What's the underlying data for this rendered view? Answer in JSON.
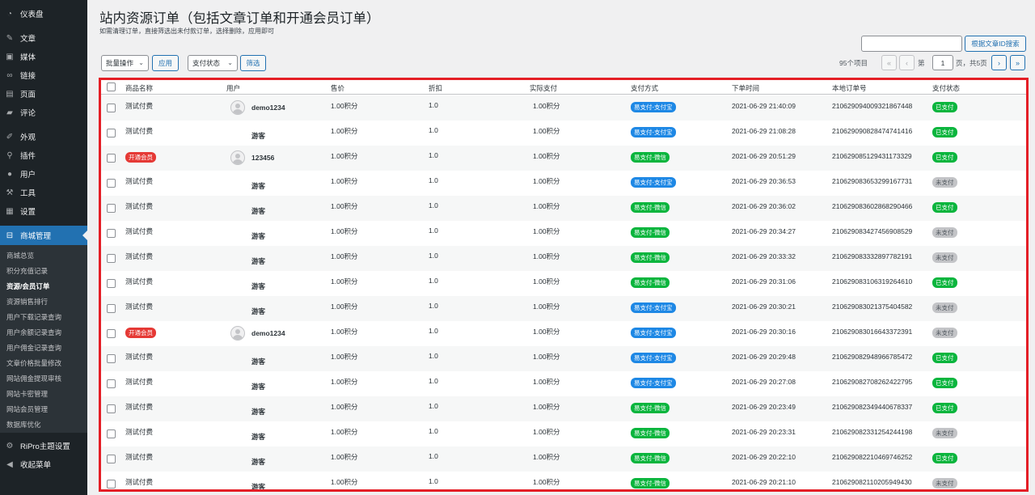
{
  "sidebar": {
    "items": [
      {
        "label": "仪表盘",
        "icon": "dashboard-icon",
        "glyph": "◔"
      },
      {
        "label": "文章",
        "icon": "pin-icon",
        "glyph": "✎"
      },
      {
        "label": "媒体",
        "icon": "media-icon",
        "glyph": "▣"
      },
      {
        "label": "链接",
        "icon": "link-icon",
        "glyph": "∞"
      },
      {
        "label": "页面",
        "icon": "page-icon",
        "glyph": "▤"
      },
      {
        "label": "评论",
        "icon": "comment-icon",
        "glyph": "▰"
      },
      {
        "label": "外观",
        "icon": "appearance-icon",
        "glyph": "✐"
      },
      {
        "label": "插件",
        "icon": "plugin-icon",
        "glyph": "⚲"
      },
      {
        "label": "用户",
        "icon": "user-icon",
        "glyph": "●"
      },
      {
        "label": "工具",
        "icon": "tools-icon",
        "glyph": "⚒"
      },
      {
        "label": "设置",
        "icon": "settings-icon",
        "glyph": "▦"
      },
      {
        "label": "商城管理",
        "icon": "cart-icon",
        "glyph": "⊟"
      },
      {
        "label": "RiPro主题设置",
        "icon": "gear-icon",
        "glyph": "⚙"
      },
      {
        "label": "收起菜单",
        "icon": "collapse-icon",
        "glyph": "◀"
      }
    ],
    "submenu": [
      "商城总览",
      "积分充值记录",
      "资源/会员订单",
      "资源销售排行",
      "用户下载记录查询",
      "用户余额记录查询",
      "用户佣金记录查询",
      "文章价格批量修改",
      "网站佣金提现审核",
      "网站卡密管理",
      "网站会员管理",
      "数据库优化"
    ]
  },
  "page": {
    "title": "站内资源订单（包括文章订单和开通会员订单）",
    "description": "如需清理订单，直接筛选出未付款订单，选择删除，应用即可"
  },
  "toolbar": {
    "bulk_label": "批量操作",
    "apply_label": "应用",
    "status_label": "支付状态",
    "filter_label": "筛选",
    "search_button": "根据文章ID搜索",
    "search_value": ""
  },
  "pagination": {
    "count": "95个项目",
    "first": "«",
    "prev": "‹",
    "page_prefix": "第",
    "current_page": "1",
    "page_suffix": "页，共5页",
    "next": "›",
    "last": "»"
  },
  "table": {
    "columns": [
      "商品名称",
      "用户",
      "售价",
      "折扣",
      "实际支付",
      "支付方式",
      "下单时间",
      "本地订单号",
      "支付状态"
    ],
    "rows": [
      {
        "product": "测试付费",
        "product_tag": false,
        "user": "demo1234",
        "avatar": true,
        "price": "1.00积分",
        "discount": "1.0",
        "paid": "1.00积分",
        "method": "易支付-支付宝",
        "method_color": "blue",
        "time": "2021-06-29 21:40:09",
        "order_no": "2106290940093218​67448",
        "status": "已支付",
        "status_color": "green"
      },
      {
        "product": "测试付费",
        "product_tag": false,
        "user": "游客",
        "avatar": false,
        "price": "1.00积分",
        "discount": "1.0",
        "paid": "1.00积分",
        "method": "易支付-支付宝",
        "method_color": "blue",
        "time": "2021-06-29 21:08:28",
        "order_no": "21062909082847474141​6",
        "status": "已支付",
        "status_color": "green"
      },
      {
        "product": "开通会员",
        "product_tag": true,
        "user": "123456",
        "avatar": true,
        "price": "1.00积分",
        "discount": "1.0",
        "paid": "1.00积分",
        "method": "易支付-微信",
        "method_color": "green",
        "time": "2021-06-29 20:51:29",
        "order_no": "210629085129431173329",
        "status": "已支付",
        "status_color": "green"
      },
      {
        "product": "测试付费",
        "product_tag": false,
        "user": "游客",
        "avatar": false,
        "price": "1.00积分",
        "discount": "1.0",
        "paid": "1.00积分",
        "method": "易支付-支付宝",
        "method_color": "blue",
        "time": "2021-06-29 20:36:53",
        "order_no": "210629083653299167731",
        "status": "未支付",
        "status_color": "gray"
      },
      {
        "product": "测试付费",
        "product_tag": false,
        "user": "游客",
        "avatar": false,
        "price": "1.00积分",
        "discount": "1.0",
        "paid": "1.00积分",
        "method": "易支付-微信",
        "method_color": "green",
        "time": "2021-06-29 20:36:02",
        "order_no": "210629083602868290466",
        "status": "已支付",
        "status_color": "green"
      },
      {
        "product": "测试付费",
        "product_tag": false,
        "user": "游客",
        "avatar": false,
        "price": "1.00积分",
        "discount": "1.0",
        "paid": "1.00积分",
        "method": "易支付-微信",
        "method_color": "green",
        "time": "2021-06-29 20:34:27",
        "order_no": "210629083427456908529",
        "status": "未支付",
        "status_color": "gray"
      },
      {
        "product": "测试付费",
        "product_tag": false,
        "user": "游客",
        "avatar": false,
        "price": "1.00积分",
        "discount": "1.0",
        "paid": "1.00积分",
        "method": "易支付-微信",
        "method_color": "green",
        "time": "2021-06-29 20:33:32",
        "order_no": "210629083332897782191",
        "status": "未支付",
        "status_color": "gray"
      },
      {
        "product": "测试付费",
        "product_tag": false,
        "user": "游客",
        "avatar": false,
        "price": "1.00积分",
        "discount": "1.0",
        "paid": "1.00积分",
        "method": "易支付-微信",
        "method_color": "green",
        "time": "2021-06-29 20:31:06",
        "order_no": "210629083106319264610",
        "status": "已支付",
        "status_color": "green"
      },
      {
        "product": "测试付费",
        "product_tag": false,
        "user": "游客",
        "avatar": false,
        "price": "1.00积分",
        "discount": "1.0",
        "paid": "1.00积分",
        "method": "易支付-支付宝",
        "method_color": "blue",
        "time": "2021-06-29 20:30:21",
        "order_no": "210629083021375404582",
        "status": "未支付",
        "status_color": "gray"
      },
      {
        "product": "开通会员",
        "product_tag": true,
        "user": "demo1234",
        "avatar": true,
        "price": "1.00积分",
        "discount": "1.0",
        "paid": "1.00积分",
        "method": "易支付-支付宝",
        "method_color": "blue",
        "time": "2021-06-29 20:30:16",
        "order_no": "210629083016643372391",
        "status": "未支付",
        "status_color": "gray"
      },
      {
        "product": "测试付费",
        "product_tag": false,
        "user": "游客",
        "avatar": false,
        "price": "1.00积分",
        "discount": "1.0",
        "paid": "1.00积分",
        "method": "易支付-支付宝",
        "method_color": "blue",
        "time": "2021-06-29 20:29:48",
        "order_no": "210629082948966785472",
        "status": "已支付",
        "status_color": "green"
      },
      {
        "product": "测试付费",
        "product_tag": false,
        "user": "游客",
        "avatar": false,
        "price": "1.00积分",
        "discount": "1.0",
        "paid": "1.00积分",
        "method": "易支付-支付宝",
        "method_color": "blue",
        "time": "2021-06-29 20:27:08",
        "order_no": "210629082708262422795",
        "status": "已支付",
        "status_color": "green"
      },
      {
        "product": "测试付费",
        "product_tag": false,
        "user": "游客",
        "avatar": false,
        "price": "1.00积分",
        "discount": "1.0",
        "paid": "1.00积分",
        "method": "易支付-微信",
        "method_color": "green",
        "time": "2021-06-29 20:23:49",
        "order_no": "210629082349440678337",
        "status": "已支付",
        "status_color": "green"
      },
      {
        "product": "测试付费",
        "product_tag": false,
        "user": "游客",
        "avatar": false,
        "price": "1.00积分",
        "discount": "1.0",
        "paid": "1.00积分",
        "method": "易支付-微信",
        "method_color": "green",
        "time": "2021-06-29 20:23:31",
        "order_no": "210629082331254244198",
        "status": "未支付",
        "status_color": "gray"
      },
      {
        "product": "测试付费",
        "product_tag": false,
        "user": "游客",
        "avatar": false,
        "price": "1.00积分",
        "discount": "1.0",
        "paid": "1.00积分",
        "method": "易支付-微信",
        "method_color": "green",
        "time": "2021-06-29 20:22:10",
        "order_no": "210629082210469746252",
        "status": "已支付",
        "status_color": "green"
      },
      {
        "product": "测试付费",
        "product_tag": false,
        "user": "游客",
        "avatar": false,
        "price": "1.00积分",
        "discount": "1.0",
        "paid": "1.00积分",
        "method": "易支付-微信",
        "method_color": "green",
        "time": "2021-06-29 20:21:10",
        "order_no": "210629082110205949430",
        "status": "未支付",
        "status_color": "gray"
      }
    ]
  },
  "colors": {
    "sidebar_bg": "#1d2327",
    "accent": "#2271b1",
    "paid_green": "#0ab53d",
    "alipay_blue": "#1e88e5",
    "vip_red": "#e53935",
    "highlight_border": "#e41e26"
  }
}
